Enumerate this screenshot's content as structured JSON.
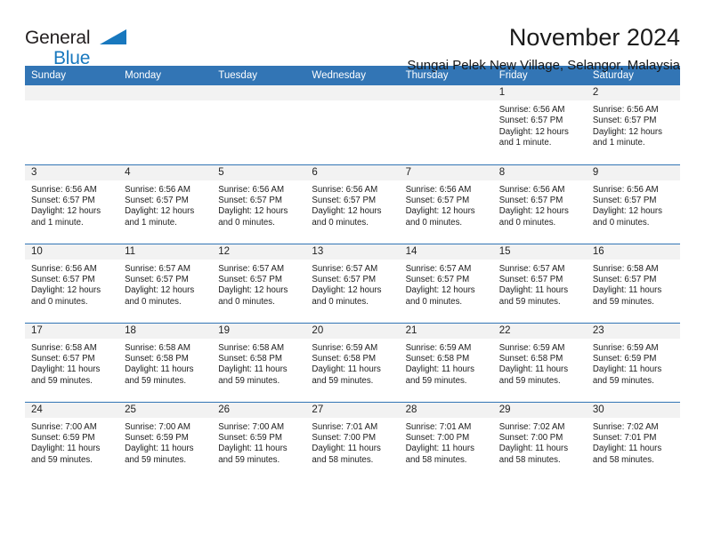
{
  "brand": {
    "name_part1": "General",
    "name_part2": "Blue",
    "flag_icon": "triangle-flag-icon",
    "accent_color": "#1878be"
  },
  "header": {
    "title": "November 2024",
    "subtitle": "Sungai Pelek New Village, Selangor, Malaysia"
  },
  "theme": {
    "header_blue": "#3275b5",
    "daynum_band_gray": "#f2f2f2",
    "text_dark": "#202020"
  },
  "weekdays": [
    "Sunday",
    "Monday",
    "Tuesday",
    "Wednesday",
    "Thursday",
    "Friday",
    "Saturday"
  ],
  "weeks": [
    [
      {
        "day": "",
        "sunrise": "",
        "sunset": "",
        "daylight": "",
        "empty": true
      },
      {
        "day": "",
        "sunrise": "",
        "sunset": "",
        "daylight": "",
        "empty": true
      },
      {
        "day": "",
        "sunrise": "",
        "sunset": "",
        "daylight": "",
        "empty": true
      },
      {
        "day": "",
        "sunrise": "",
        "sunset": "",
        "daylight": "",
        "empty": true
      },
      {
        "day": "",
        "sunrise": "",
        "sunset": "",
        "daylight": "",
        "empty": true
      },
      {
        "day": "1",
        "sunrise": "Sunrise: 6:56 AM",
        "sunset": "Sunset: 6:57 PM",
        "daylight": "Daylight: 12 hours and 1 minute.",
        "empty": false
      },
      {
        "day": "2",
        "sunrise": "Sunrise: 6:56 AM",
        "sunset": "Sunset: 6:57 PM",
        "daylight": "Daylight: 12 hours and 1 minute.",
        "empty": false
      }
    ],
    [
      {
        "day": "3",
        "sunrise": "Sunrise: 6:56 AM",
        "sunset": "Sunset: 6:57 PM",
        "daylight": "Daylight: 12 hours and 1 minute.",
        "empty": false
      },
      {
        "day": "4",
        "sunrise": "Sunrise: 6:56 AM",
        "sunset": "Sunset: 6:57 PM",
        "daylight": "Daylight: 12 hours and 1 minute.",
        "empty": false
      },
      {
        "day": "5",
        "sunrise": "Sunrise: 6:56 AM",
        "sunset": "Sunset: 6:57 PM",
        "daylight": "Daylight: 12 hours and 0 minutes.",
        "empty": false
      },
      {
        "day": "6",
        "sunrise": "Sunrise: 6:56 AM",
        "sunset": "Sunset: 6:57 PM",
        "daylight": "Daylight: 12 hours and 0 minutes.",
        "empty": false
      },
      {
        "day": "7",
        "sunrise": "Sunrise: 6:56 AM",
        "sunset": "Sunset: 6:57 PM",
        "daylight": "Daylight: 12 hours and 0 minutes.",
        "empty": false
      },
      {
        "day": "8",
        "sunrise": "Sunrise: 6:56 AM",
        "sunset": "Sunset: 6:57 PM",
        "daylight": "Daylight: 12 hours and 0 minutes.",
        "empty": false
      },
      {
        "day": "9",
        "sunrise": "Sunrise: 6:56 AM",
        "sunset": "Sunset: 6:57 PM",
        "daylight": "Daylight: 12 hours and 0 minutes.",
        "empty": false
      }
    ],
    [
      {
        "day": "10",
        "sunrise": "Sunrise: 6:56 AM",
        "sunset": "Sunset: 6:57 PM",
        "daylight": "Daylight: 12 hours and 0 minutes.",
        "empty": false
      },
      {
        "day": "11",
        "sunrise": "Sunrise: 6:57 AM",
        "sunset": "Sunset: 6:57 PM",
        "daylight": "Daylight: 12 hours and 0 minutes.",
        "empty": false
      },
      {
        "day": "12",
        "sunrise": "Sunrise: 6:57 AM",
        "sunset": "Sunset: 6:57 PM",
        "daylight": "Daylight: 12 hours and 0 minutes.",
        "empty": false
      },
      {
        "day": "13",
        "sunrise": "Sunrise: 6:57 AM",
        "sunset": "Sunset: 6:57 PM",
        "daylight": "Daylight: 12 hours and 0 minutes.",
        "empty": false
      },
      {
        "day": "14",
        "sunrise": "Sunrise: 6:57 AM",
        "sunset": "Sunset: 6:57 PM",
        "daylight": "Daylight: 12 hours and 0 minutes.",
        "empty": false
      },
      {
        "day": "15",
        "sunrise": "Sunrise: 6:57 AM",
        "sunset": "Sunset: 6:57 PM",
        "daylight": "Daylight: 11 hours and 59 minutes.",
        "empty": false
      },
      {
        "day": "16",
        "sunrise": "Sunrise: 6:58 AM",
        "sunset": "Sunset: 6:57 PM",
        "daylight": "Daylight: 11 hours and 59 minutes.",
        "empty": false
      }
    ],
    [
      {
        "day": "17",
        "sunrise": "Sunrise: 6:58 AM",
        "sunset": "Sunset: 6:57 PM",
        "daylight": "Daylight: 11 hours and 59 minutes.",
        "empty": false
      },
      {
        "day": "18",
        "sunrise": "Sunrise: 6:58 AM",
        "sunset": "Sunset: 6:58 PM",
        "daylight": "Daylight: 11 hours and 59 minutes.",
        "empty": false
      },
      {
        "day": "19",
        "sunrise": "Sunrise: 6:58 AM",
        "sunset": "Sunset: 6:58 PM",
        "daylight": "Daylight: 11 hours and 59 minutes.",
        "empty": false
      },
      {
        "day": "20",
        "sunrise": "Sunrise: 6:59 AM",
        "sunset": "Sunset: 6:58 PM",
        "daylight": "Daylight: 11 hours and 59 minutes.",
        "empty": false
      },
      {
        "day": "21",
        "sunrise": "Sunrise: 6:59 AM",
        "sunset": "Sunset: 6:58 PM",
        "daylight": "Daylight: 11 hours and 59 minutes.",
        "empty": false
      },
      {
        "day": "22",
        "sunrise": "Sunrise: 6:59 AM",
        "sunset": "Sunset: 6:58 PM",
        "daylight": "Daylight: 11 hours and 59 minutes.",
        "empty": false
      },
      {
        "day": "23",
        "sunrise": "Sunrise: 6:59 AM",
        "sunset": "Sunset: 6:59 PM",
        "daylight": "Daylight: 11 hours and 59 minutes.",
        "empty": false
      }
    ],
    [
      {
        "day": "24",
        "sunrise": "Sunrise: 7:00 AM",
        "sunset": "Sunset: 6:59 PM",
        "daylight": "Daylight: 11 hours and 59 minutes.",
        "empty": false
      },
      {
        "day": "25",
        "sunrise": "Sunrise: 7:00 AM",
        "sunset": "Sunset: 6:59 PM",
        "daylight": "Daylight: 11 hours and 59 minutes.",
        "empty": false
      },
      {
        "day": "26",
        "sunrise": "Sunrise: 7:00 AM",
        "sunset": "Sunset: 6:59 PM",
        "daylight": "Daylight: 11 hours and 59 minutes.",
        "empty": false
      },
      {
        "day": "27",
        "sunrise": "Sunrise: 7:01 AM",
        "sunset": "Sunset: 7:00 PM",
        "daylight": "Daylight: 11 hours and 58 minutes.",
        "empty": false
      },
      {
        "day": "28",
        "sunrise": "Sunrise: 7:01 AM",
        "sunset": "Sunset: 7:00 PM",
        "daylight": "Daylight: 11 hours and 58 minutes.",
        "empty": false
      },
      {
        "day": "29",
        "sunrise": "Sunrise: 7:02 AM",
        "sunset": "Sunset: 7:00 PM",
        "daylight": "Daylight: 11 hours and 58 minutes.",
        "empty": false
      },
      {
        "day": "30",
        "sunrise": "Sunrise: 7:02 AM",
        "sunset": "Sunset: 7:01 PM",
        "daylight": "Daylight: 11 hours and 58 minutes.",
        "empty": false
      }
    ]
  ]
}
